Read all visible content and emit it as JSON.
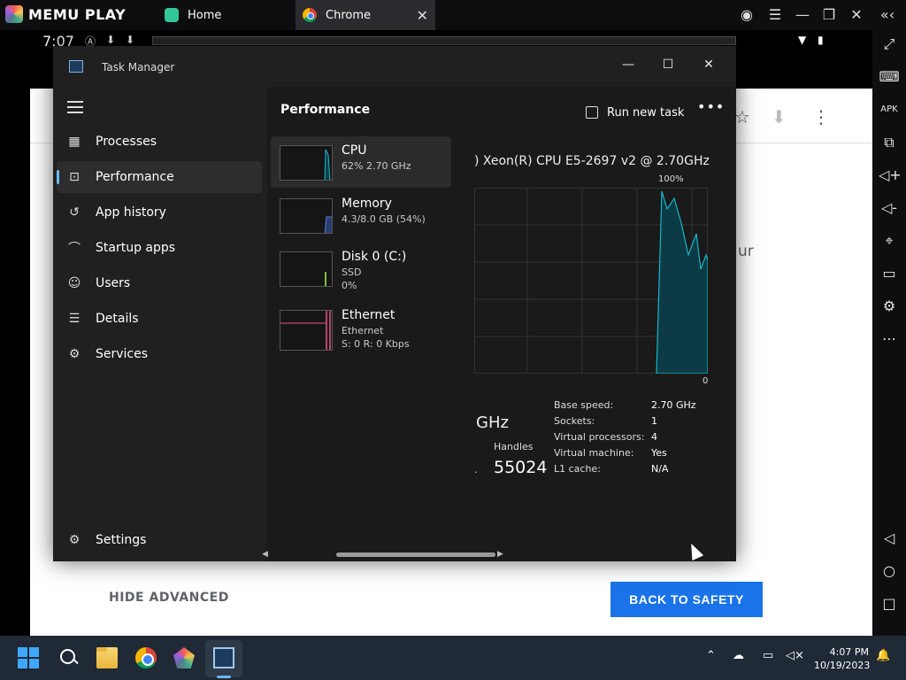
{
  "memu": {
    "logo": "MEMU PLAY",
    "tabs": [
      {
        "label": "Home"
      },
      {
        "label": "Chrome"
      }
    ]
  },
  "android": {
    "status_time": "7:07",
    "partial_text": "ur",
    "hide_advanced": "HIDE ADVANCED",
    "back_to_safety": "BACK TO SAFETY"
  },
  "task_manager": {
    "title": "Task Manager",
    "nav": [
      {
        "label": "Processes",
        "icon": "processes-icon"
      },
      {
        "label": "Performance",
        "icon": "performance-icon"
      },
      {
        "label": "App history",
        "icon": "app-history-icon"
      },
      {
        "label": "Startup apps",
        "icon": "startup-apps-icon"
      },
      {
        "label": "Users",
        "icon": "users-icon"
      },
      {
        "label": "Details",
        "icon": "details-icon"
      },
      {
        "label": "Services",
        "icon": "services-icon"
      }
    ],
    "settings": "Settings",
    "heading": "Performance",
    "run_new_task": "Run new task",
    "resources": [
      {
        "name": "CPU",
        "sub1": "62%  2.70 GHz"
      },
      {
        "name": "Memory",
        "sub1": "4.3/8.0 GB (54%)"
      },
      {
        "name": "Disk 0 (C:)",
        "sub1": "SSD",
        "sub2": "0%"
      },
      {
        "name": "Ethernet",
        "sub1": "Ethernet",
        "sub2": "S: 0  R: 0 Kbps"
      }
    ],
    "cpu": {
      "model": ") Xeon(R) CPU E5-2697 v2 @ 2.70GHz",
      "graph_max": "100%",
      "graph_min": "0",
      "speed_partial": "GHz",
      "handles_label": "Handles",
      "handles_value": "55024",
      "dot": ".",
      "specs": [
        {
          "label": "Base speed:",
          "value": "2.70 GHz"
        },
        {
          "label": "Sockets:",
          "value": "1"
        },
        {
          "label": "Virtual processors:",
          "value": "4"
        },
        {
          "label": "Virtual machine:",
          "value": "Yes"
        },
        {
          "label": "L1 cache:",
          "value": "N/A"
        }
      ]
    }
  },
  "taskbar": {
    "time": "4:07 PM",
    "date": "10/19/2023"
  },
  "colors": {
    "accent": "#6ab7ff",
    "cpu_graph": "#17b6c8",
    "memory_graph": "#5b7fe0",
    "disk_graph": "#7fbf3f",
    "ethernet_graph": "#e5578e",
    "safety_button": "#1a73e8"
  }
}
